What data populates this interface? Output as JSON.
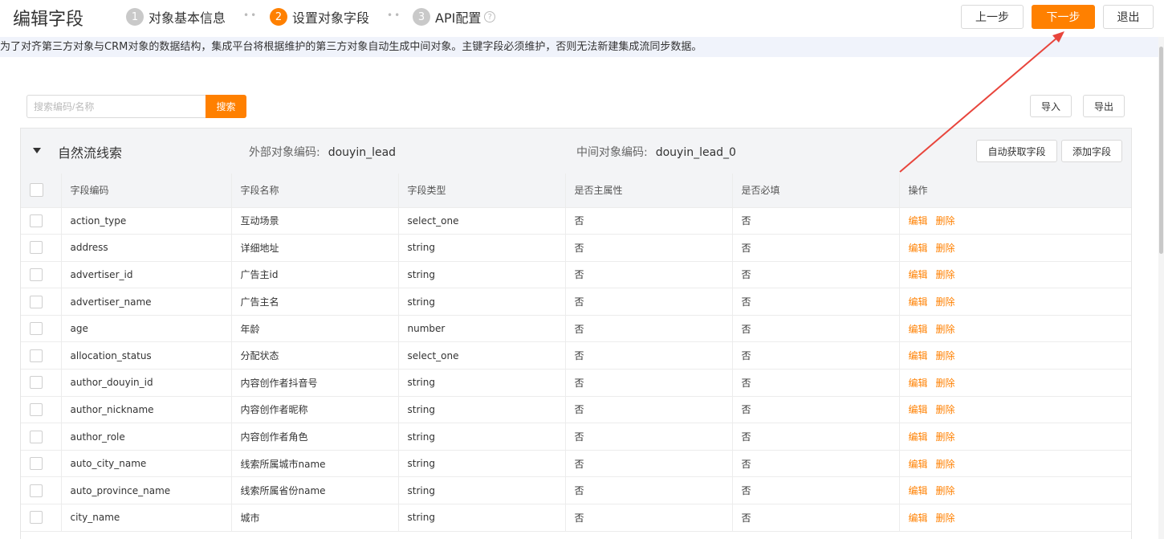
{
  "header": {
    "title": "编辑字段",
    "steps": [
      {
        "num": "1",
        "label": "对象基本信息"
      },
      {
        "num": "2",
        "label": "设置对象字段"
      },
      {
        "num": "3",
        "label": "API配置"
      }
    ],
    "prev_label": "上一步",
    "next_label": "下一步",
    "exit_label": "退出"
  },
  "notice": "为了对齐第三方对象与CRM对象的数据结构，集成平台将根据维护的第三方对象自动生成中间对象。主键字段必须维护，否则无法新建集成流同步数据。",
  "search": {
    "placeholder": "搜索编码/名称",
    "button": "搜索"
  },
  "toolbar": {
    "import_label": "导入",
    "export_label": "导出"
  },
  "object": {
    "name": "自然流线索",
    "external_code_label": "外部对象编码:",
    "external_code": "douyin_lead",
    "middle_code_label": "中间对象编码:",
    "middle_code": "douyin_lead_0",
    "auto_fetch_label": "自动获取字段",
    "add_field_label": "添加字段"
  },
  "table": {
    "columns": [
      "字段编码",
      "字段名称",
      "字段类型",
      "是否主属性",
      "是否必填",
      "操作"
    ],
    "edit_label": "编辑",
    "delete_label": "删除",
    "rows": [
      {
        "code": "action_type",
        "name": "互动场景",
        "type": "select_one",
        "primary": "否",
        "required": "否"
      },
      {
        "code": "address",
        "name": "详细地址",
        "type": "string",
        "primary": "否",
        "required": "否"
      },
      {
        "code": "advertiser_id",
        "name": "广告主id",
        "type": "string",
        "primary": "否",
        "required": "否"
      },
      {
        "code": "advertiser_name",
        "name": "广告主名",
        "type": "string",
        "primary": "否",
        "required": "否"
      },
      {
        "code": "age",
        "name": "年龄",
        "type": "number",
        "primary": "否",
        "required": "否"
      },
      {
        "code": "allocation_status",
        "name": "分配状态",
        "type": "select_one",
        "primary": "否",
        "required": "否"
      },
      {
        "code": "author_douyin_id",
        "name": "内容创作者抖音号",
        "type": "string",
        "primary": "否",
        "required": "否"
      },
      {
        "code": "author_nickname",
        "name": "内容创作者昵称",
        "type": "string",
        "primary": "否",
        "required": "否"
      },
      {
        "code": "author_role",
        "name": "内容创作者角色",
        "type": "string",
        "primary": "否",
        "required": "否"
      },
      {
        "code": "auto_city_name",
        "name": "线索所属城市name",
        "type": "string",
        "primary": "否",
        "required": "否"
      },
      {
        "code": "auto_province_name",
        "name": "线索所属省份name",
        "type": "string",
        "primary": "否",
        "required": "否"
      },
      {
        "code": "city_name",
        "name": "城市",
        "type": "string",
        "primary": "否",
        "required": "否"
      }
    ]
  }
}
